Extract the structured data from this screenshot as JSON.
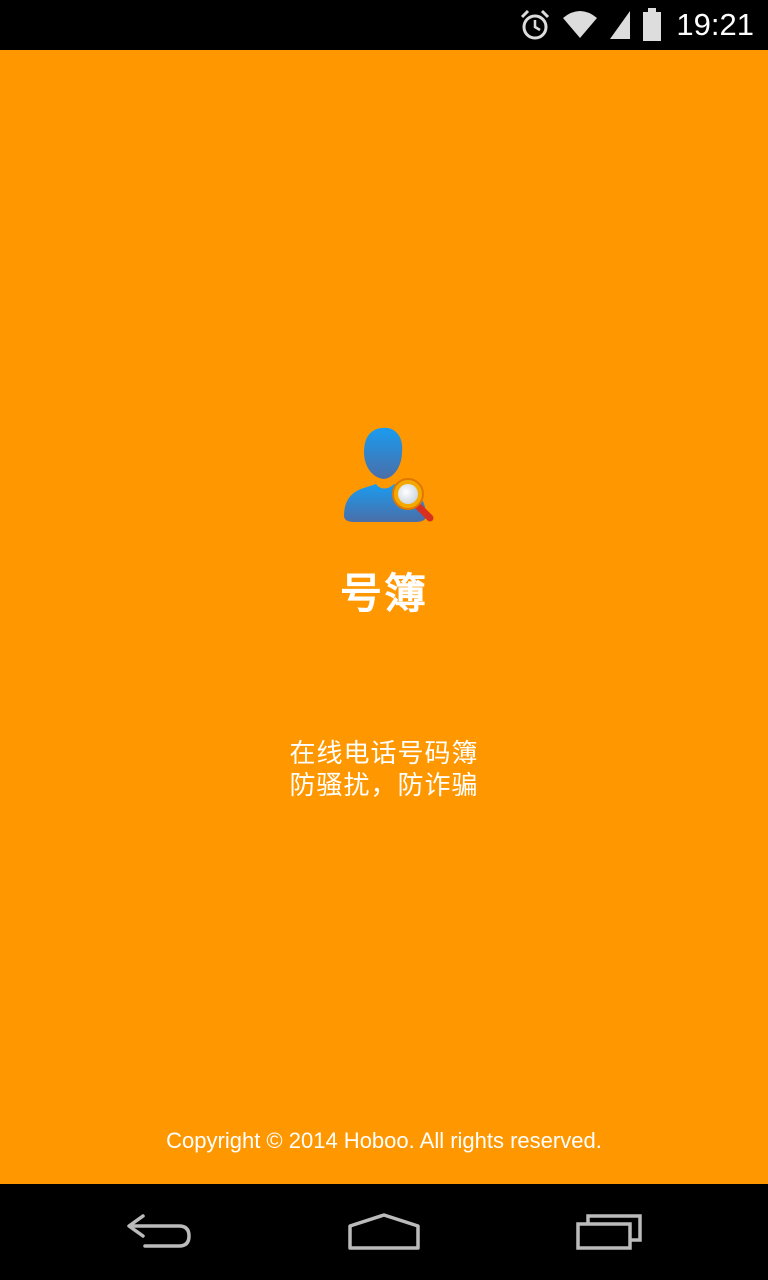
{
  "status_bar": {
    "time": "19:21",
    "icons": [
      "alarm-icon",
      "wifi-icon",
      "signal-icon",
      "battery-icon"
    ]
  },
  "splash": {
    "background_color": "#ff9800",
    "app_icon": "contact-search-icon",
    "app_name": "号簿",
    "tagline_line1": "在线电话号码簿",
    "tagline_line2": "防骚扰，防诈骗",
    "copyright": "Copyright © 2014 Hoboo. All rights reserved."
  },
  "nav_bar": {
    "buttons": [
      "back-icon",
      "home-icon",
      "recents-icon"
    ]
  }
}
